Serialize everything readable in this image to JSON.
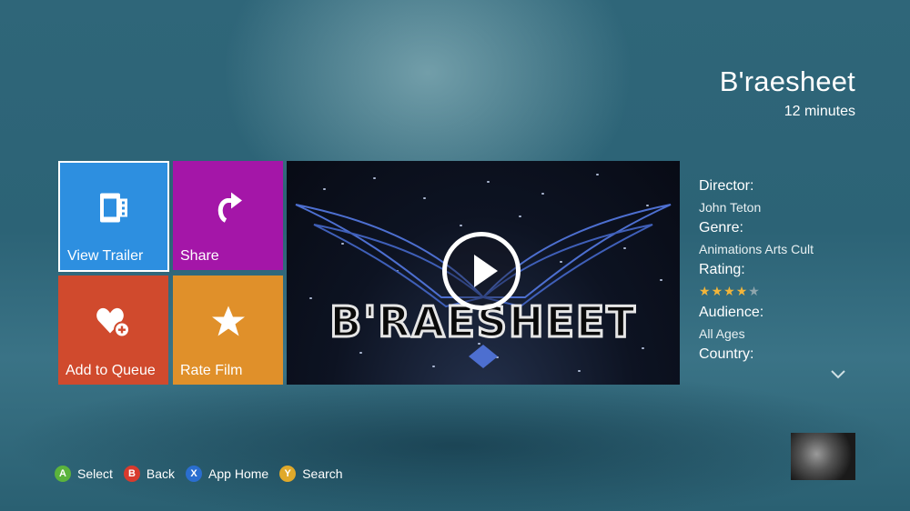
{
  "header": {
    "title": "B'raesheet",
    "duration": "12 minutes"
  },
  "tiles": [
    {
      "label": "View Trailer",
      "color": "#2d8fe0",
      "icon": "film-reel-icon",
      "selected": true
    },
    {
      "label": "Share",
      "color": "#a416a8",
      "icon": "share-arrow-icon"
    },
    {
      "label": "Add to Queue",
      "color": "#d04a2d",
      "icon": "heart-plus-icon"
    },
    {
      "label": "Rate Film",
      "color": "#e0902a",
      "icon": "star-icon"
    }
  ],
  "hero": {
    "wordmark": "B'RAESHEET",
    "icon": "play-icon"
  },
  "details": {
    "director_label": "Director:",
    "director": "John Teton",
    "genre_label": "Genre:",
    "genre": "Animations Arts Cult",
    "rating_label": "Rating:",
    "rating_value": 3.5,
    "rating_max": 5,
    "audience_label": "Audience:",
    "audience": "All Ages",
    "country_label": "Country:"
  },
  "controller_hints": [
    {
      "button": "A",
      "label": "Select",
      "color": "#5bb33c"
    },
    {
      "button": "B",
      "label": "Back",
      "color": "#d83a2d"
    },
    {
      "button": "X",
      "label": "App Home",
      "color": "#2a6ed0"
    },
    {
      "button": "Y",
      "label": "Search",
      "color": "#e0a92a"
    }
  ]
}
